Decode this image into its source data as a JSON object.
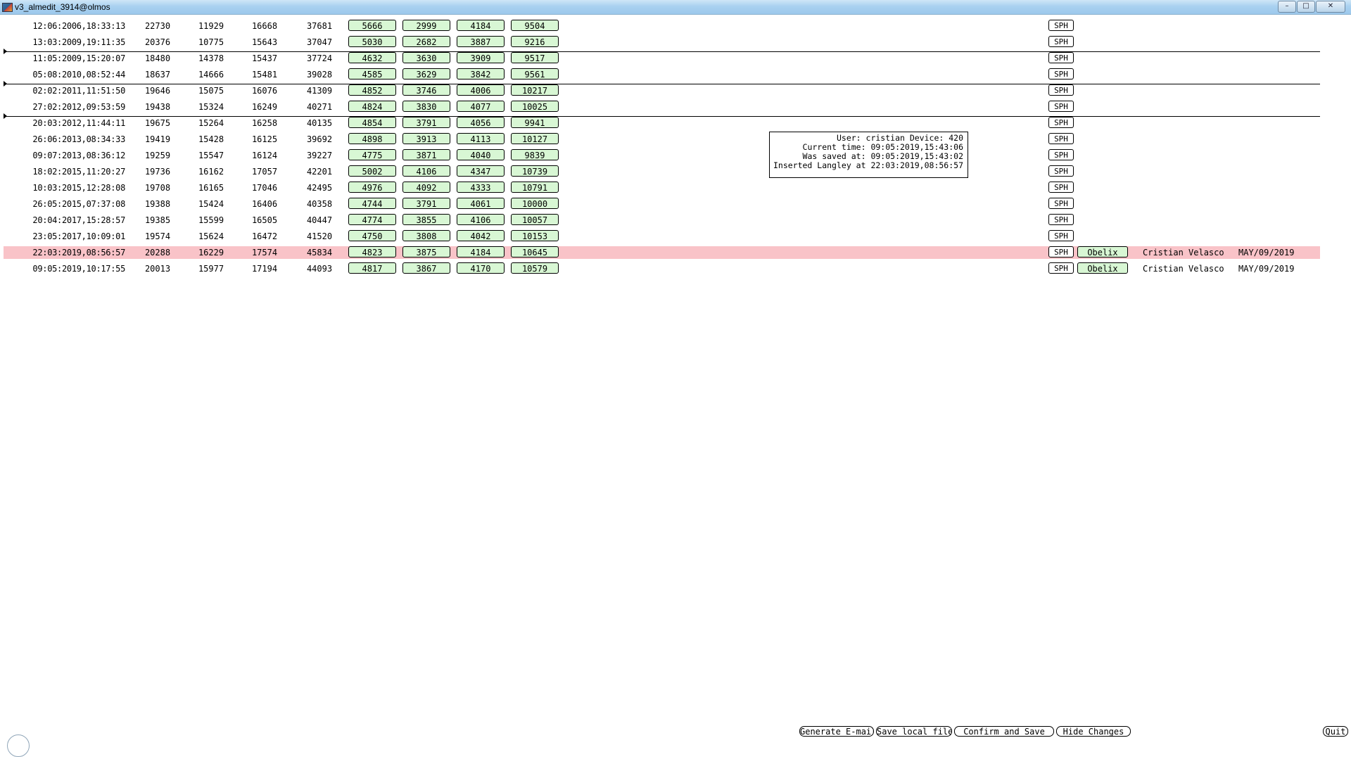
{
  "window": {
    "title": "v3_almedit_3914@olmos",
    "minimize_glyph": "–",
    "maximize_glyph": "□",
    "close_glyph": "✕"
  },
  "rows": [
    {
      "date": "12:06:2006,18:33:13",
      "n1": "22730",
      "n2": "11929",
      "n3": "16668",
      "n4": "37681",
      "g1": "5666",
      "g2": "2999",
      "g3": "4184",
      "g4": "9504",
      "sph": "SPH"
    },
    {
      "date": "13:03:2009,19:11:35",
      "n1": "20376",
      "n2": "10775",
      "n3": "15643",
      "n4": "37047",
      "g1": "5030",
      "g2": "2682",
      "g3": "3887",
      "g4": "9216",
      "sph": "SPH"
    },
    {
      "date": "11:05:2009,15:20:07",
      "n1": "18480",
      "n2": "14378",
      "n3": "15437",
      "n4": "37724",
      "g1": "4632",
      "g2": "3630",
      "g3": "3909",
      "g4": "9517",
      "sph": "SPH"
    },
    {
      "date": "05:08:2010,08:52:44",
      "n1": "18637",
      "n2": "14666",
      "n3": "15481",
      "n4": "39028",
      "g1": "4585",
      "g2": "3629",
      "g3": "3842",
      "g4": "9561",
      "sph": "SPH"
    },
    {
      "date": "02:02:2011,11:51:50",
      "n1": "19646",
      "n2": "15075",
      "n3": "16076",
      "n4": "41309",
      "g1": "4852",
      "g2": "3746",
      "g3": "4006",
      "g4": "10217",
      "sph": "SPH"
    },
    {
      "date": "27:02:2012,09:53:59",
      "n1": "19438",
      "n2": "15324",
      "n3": "16249",
      "n4": "40271",
      "g1": "4824",
      "g2": "3830",
      "g3": "4077",
      "g4": "10025",
      "sph": "SPH"
    },
    {
      "date": "20:03:2012,11:44:11",
      "n1": "19675",
      "n2": "15264",
      "n3": "16258",
      "n4": "40135",
      "g1": "4854",
      "g2": "3791",
      "g3": "4056",
      "g4": "9941",
      "sph": "SPH"
    },
    {
      "date": "26:06:2013,08:34:33",
      "n1": "19419",
      "n2": "15428",
      "n3": "16125",
      "n4": "39692",
      "g1": "4898",
      "g2": "3913",
      "g3": "4113",
      "g4": "10127",
      "sph": "SPH"
    },
    {
      "date": "09:07:2013,08:36:12",
      "n1": "19259",
      "n2": "15547",
      "n3": "16124",
      "n4": "39227",
      "g1": "4775",
      "g2": "3871",
      "g3": "4040",
      "g4": "9839",
      "sph": "SPH"
    },
    {
      "date": "18:02:2015,11:20:27",
      "n1": "19736",
      "n2": "16162",
      "n3": "17057",
      "n4": "42201",
      "g1": "5002",
      "g2": "4106",
      "g3": "4347",
      "g4": "10739",
      "sph": "SPH"
    },
    {
      "date": "10:03:2015,12:28:08",
      "n1": "19708",
      "n2": "16165",
      "n3": "17046",
      "n4": "42495",
      "g1": "4976",
      "g2": "4092",
      "g3": "4333",
      "g4": "10791",
      "sph": "SPH"
    },
    {
      "date": "26:05:2015,07:37:08",
      "n1": "19388",
      "n2": "15424",
      "n3": "16406",
      "n4": "40358",
      "g1": "4744",
      "g2": "3791",
      "g3": "4061",
      "g4": "10000",
      "sph": "SPH"
    },
    {
      "date": "20:04:2017,15:28:57",
      "n1": "19385",
      "n2": "15599",
      "n3": "16505",
      "n4": "40447",
      "g1": "4774",
      "g2": "3855",
      "g3": "4106",
      "g4": "10057",
      "sph": "SPH"
    },
    {
      "date": "23:05:2017,10:09:01",
      "n1": "19574",
      "n2": "15624",
      "n3": "16472",
      "n4": "41520",
      "g1": "4750",
      "g2": "3808",
      "g3": "4042",
      "g4": "10153",
      "sph": "SPH"
    },
    {
      "date": "22:03:2019,08:56:57",
      "n1": "20288",
      "n2": "16229",
      "n3": "17574",
      "n4": "45834",
      "g1": "4823",
      "g2": "3875",
      "g3": "4184",
      "g4": "10645",
      "sph": "SPH",
      "device": "Obelix",
      "user": "Cristian Velasco",
      "udate": "MAY/09/2019",
      "highlight": true
    },
    {
      "date": "09:05:2019,10:17:55",
      "n1": "20013",
      "n2": "15977",
      "n3": "17194",
      "n4": "44093",
      "g1": "4817",
      "g2": "3867",
      "g3": "4170",
      "g4": "10579",
      "sph": "SPH",
      "device": "Obelix",
      "user": "Cristian Velasco",
      "udate": "MAY/09/2019"
    }
  ],
  "info_box": {
    "line1": "User: cristian Device: 420",
    "line2": "Current time: 09:05:2019,15:43:06",
    "line3": "Was saved at: 09:05:2019,15:43:02",
    "line4": "Inserted Langley at 22:03:2019,08:56:57"
  },
  "bottom_bar": {
    "generate_email": "Generate E-mail",
    "save_local_file": "Save local file",
    "confirm_and_save": "Confirm and Save",
    "hide_changes": "Hide Changes",
    "quit": "Quit"
  },
  "colors": {
    "highlight_row": "#f9c3c8",
    "value_button": "#d8f7d4",
    "titlebar": "#a9d1f0"
  }
}
